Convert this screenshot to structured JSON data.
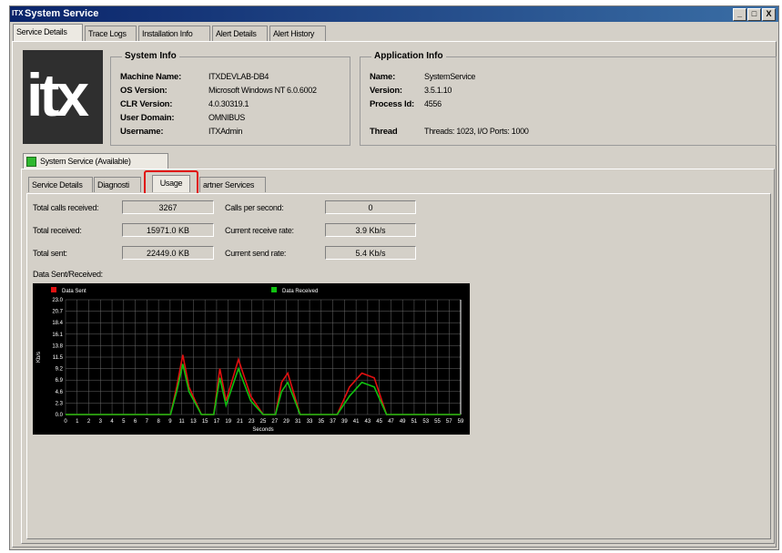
{
  "window": {
    "title": "System Service",
    "icon": "itx-icon",
    "buttons": [
      "_",
      "□",
      "X"
    ]
  },
  "main_tabs": [
    {
      "label": "Service Details",
      "active": true
    },
    {
      "label": "Trace Logs",
      "active": false
    },
    {
      "label": "Installation Info",
      "active": false
    },
    {
      "label": "Alert Details",
      "active": false
    },
    {
      "label": "Alert History",
      "active": false
    }
  ],
  "logo_text": "itx",
  "system_info": {
    "title": "System Info",
    "rows": [
      {
        "label": "Machine Name:",
        "value": "ITXDEVLAB-DB4"
      },
      {
        "label": "OS Version:",
        "value": "Microsoft Windows NT 6.0.6002"
      },
      {
        "label": "CLR Version:",
        "value": "4.0.30319.1"
      },
      {
        "label": "User Domain:",
        "value": "OMNIBUS"
      },
      {
        "label": "Username:",
        "value": "ITXAdmin"
      }
    ]
  },
  "application_info": {
    "title": "Application Info",
    "rows": [
      {
        "label": "Name:",
        "value": "SystemService"
      },
      {
        "label": "Version:",
        "value": "3.5.1.10"
      },
      {
        "label": "Process Id:",
        "value": "4556"
      }
    ],
    "thread_label": "Thread",
    "thread_value": "Threads: 1023, I/O Ports: 1000"
  },
  "service_tab": {
    "label": "System Service (Available)",
    "status_color": "#2fb82f"
  },
  "sub_tabs": [
    {
      "label": "Service Details",
      "active": false
    },
    {
      "label": "Diagnosti",
      "active": false
    },
    {
      "label": "Usage",
      "active": true
    },
    {
      "label": "artner Services",
      "active": false
    }
  ],
  "usage": {
    "left": [
      {
        "label": "Total calls received:",
        "value": "3267"
      },
      {
        "label": "Total received:",
        "value": "15971.0 KB"
      },
      {
        "label": "Total sent:",
        "value": "22449.0 KB"
      }
    ],
    "right": [
      {
        "label": "Calls per second:",
        "value": "0"
      },
      {
        "label": "Current receive rate:",
        "value": "3.9 Kb/s"
      },
      {
        "label": "Current send rate:",
        "value": "5.4 Kb/s"
      }
    ],
    "chart_title": "Data Sent/Received:"
  },
  "chart_data": {
    "type": "line",
    "title": "",
    "xlabel": "Seconds",
    "ylabel": "Kb/s",
    "ylim": [
      0,
      25
    ],
    "yticks": [
      "0.0",
      "2.3",
      "4.6",
      "6.9",
      "9.2",
      "11.5",
      "13.8",
      "16.1",
      "18.4",
      "20.7",
      "23.0"
    ],
    "xticks": [
      "0",
      "1",
      "2",
      "3",
      "4",
      "5",
      "6",
      "7",
      "8",
      "9",
      "11",
      "13",
      "15",
      "17",
      "19",
      "21",
      "23",
      "25",
      "27",
      "29",
      "31",
      "33",
      "35",
      "37",
      "39",
      "41",
      "43",
      "45",
      "47",
      "49",
      "51",
      "53",
      "55",
      "57",
      "59"
    ],
    "x": [
      0,
      2,
      4,
      6,
      8,
      10,
      12,
      14,
      16,
      17,
      18,
      19,
      20,
      22,
      24,
      25,
      26,
      28,
      30,
      32,
      34,
      35,
      36,
      38,
      40,
      42,
      44,
      46,
      48,
      50,
      52,
      54,
      56,
      58,
      60,
      62,
      64
    ],
    "series": [
      {
        "name": "Data Sent",
        "color": "#e01010",
        "values": [
          0,
          0,
          0,
          0,
          0,
          0,
          0,
          0,
          0,
          0,
          6,
          13,
          6,
          0,
          0,
          10,
          3,
          12,
          4,
          0,
          0,
          7,
          9,
          0,
          0,
          0,
          0,
          6,
          9,
          8,
          0,
          0,
          0,
          0,
          0,
          0,
          0
        ]
      },
      {
        "name": "Data Received",
        "color": "#10c010",
        "values": [
          0,
          0,
          0,
          0,
          0,
          0,
          0,
          0,
          0,
          0,
          5,
          11,
          5,
          0,
          0,
          8,
          2,
          10,
          3,
          0,
          0,
          5,
          7,
          0,
          0,
          0,
          0,
          4,
          7,
          6,
          0,
          0,
          0,
          0,
          0,
          0,
          0
        ]
      }
    ],
    "legend": "top",
    "grid": true
  }
}
